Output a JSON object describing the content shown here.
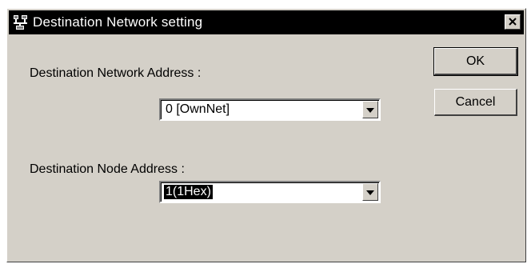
{
  "dialog": {
    "title": "Destination Network setting",
    "close_glyph": "✕",
    "app_icon": "network-icon"
  },
  "network": {
    "label": "Destination Network Address :",
    "value": "0 [OwnNet]"
  },
  "node": {
    "label": "Destination Node Address :",
    "value": "1(1Hex)"
  },
  "buttons": {
    "ok": "OK",
    "cancel": "Cancel"
  },
  "colors": {
    "face": "#d4d0c8",
    "titlebar": "#000000",
    "selection": "#000000"
  }
}
